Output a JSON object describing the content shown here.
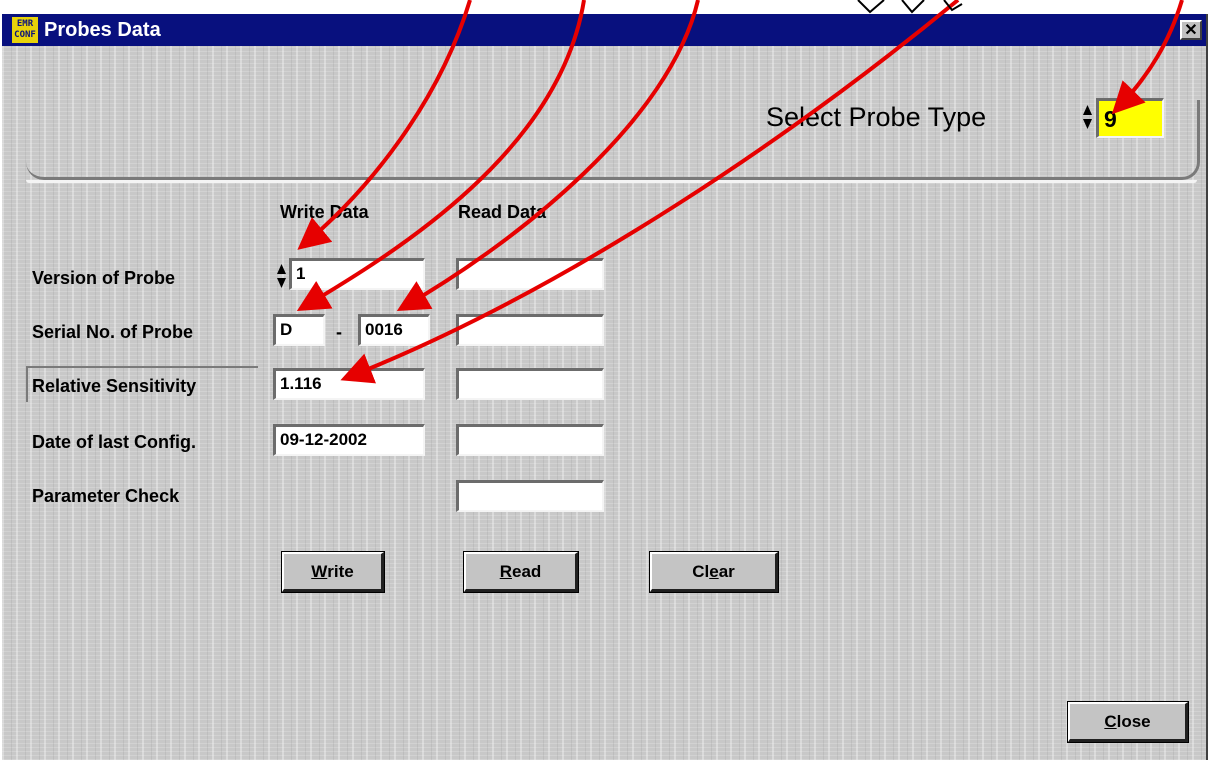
{
  "window": {
    "title": "Probes Data",
    "app_icon_text": [
      "EMR",
      "CONF"
    ],
    "close_glyph": "✕"
  },
  "probe_type": {
    "label": "Select Probe Type",
    "value": "9",
    "highlight": "#ffff00"
  },
  "columns": {
    "write": "Write Data",
    "read": "Read Data"
  },
  "rows": {
    "version": {
      "label": "Version of Probe",
      "write_value": "1",
      "read_value": ""
    },
    "serial": {
      "label": "Serial No. of Probe",
      "prefix": "D",
      "separator": "-",
      "number": "0016",
      "read_value": ""
    },
    "sensitivity": {
      "label": "Relative Sensitivity",
      "write_value": "1.116",
      "read_value": ""
    },
    "date": {
      "label": "Date of last Config.",
      "write_value": "09-12-2002",
      "read_value": ""
    },
    "param": {
      "label": "Parameter Check",
      "read_value": ""
    }
  },
  "buttons": {
    "write": {
      "accel": "W",
      "rest": "rite"
    },
    "read": {
      "accel": "R",
      "rest": "ead"
    },
    "clear": {
      "pre": "Cl",
      "accel": "e",
      "rest": "ar"
    },
    "close": {
      "accel": "C",
      "rest": "lose"
    }
  },
  "colors": {
    "titlebar": "#08107e",
    "arrows": "#e60000",
    "face": "#c4c4c4"
  }
}
